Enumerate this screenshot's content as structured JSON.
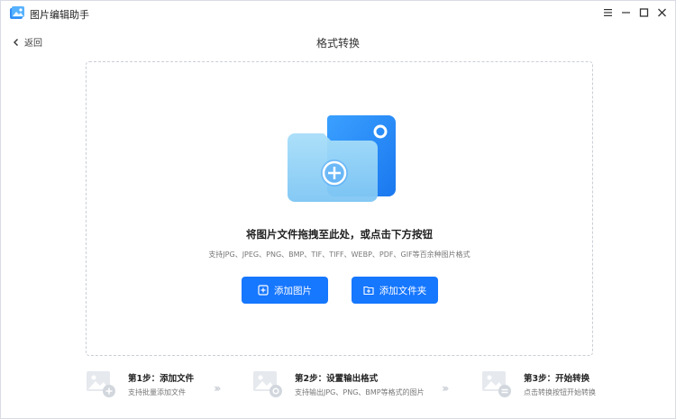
{
  "app": {
    "title": "图片编辑助手"
  },
  "header": {
    "back_label": "返回",
    "page_title": "格式转换"
  },
  "dropzone": {
    "main_text": "将图片文件拖拽至此处，或点击下方按钮",
    "sub_text": "支持JPG、JPEG、PNG、BMP、TIF、TIFF、WEBP、PDF、GIF等百余种图片格式",
    "add_image_label": "添加图片",
    "add_folder_label": "添加文件夹"
  },
  "steps": [
    {
      "title": "第1步：添加文件",
      "desc": "支持批量添加文件"
    },
    {
      "title": "第2步：设置输出格式",
      "desc": "支持输出JPG、PNG、BMP等格式的图片"
    },
    {
      "title": "第3步：开始转换",
      "desc": "点击转换按钮开始转换"
    }
  ],
  "colors": {
    "accent": "#1677ff",
    "folder_back": "#2f8ef7",
    "folder_front": "#8fd0f7"
  },
  "icons": {
    "logo": "app-logo-icon",
    "menu": "menu-icon",
    "minimize": "minimize-icon",
    "maximize": "maximize-icon",
    "close": "close-icon",
    "back": "chevron-left-icon"
  }
}
